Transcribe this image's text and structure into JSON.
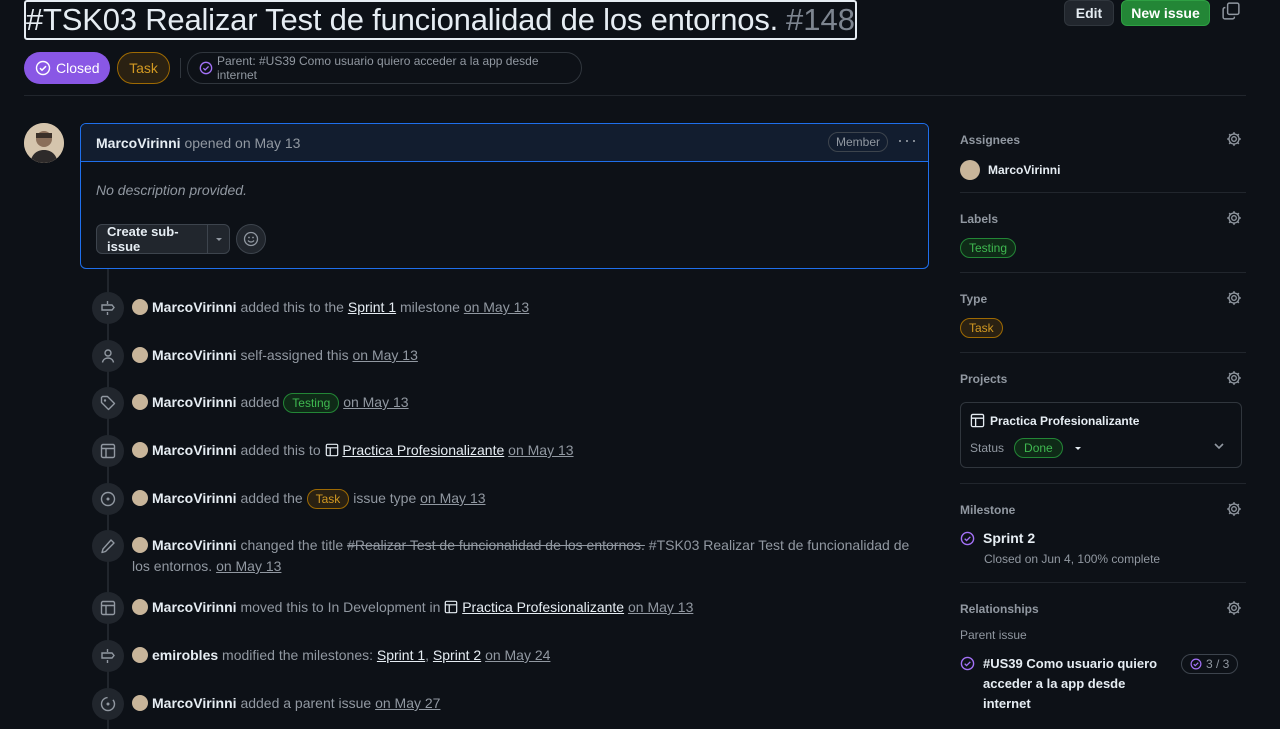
{
  "header": {
    "title": "#TSK03 Realizar Test de funcionalidad de los entornos.",
    "number": "#148",
    "edit_label": "Edit",
    "new_issue_label": "New issue"
  },
  "status": {
    "state_label": "Closed",
    "type_label": "Task",
    "parent_text": "Parent: #US39 Como usuario quiero acceder a la app desde internet"
  },
  "comment": {
    "author": "MarcoVirinni",
    "opened_text": "opened on May 13",
    "role_badge": "Member",
    "body": "No description provided.",
    "sub_issue_label": "Create sub-issue"
  },
  "timeline": [
    {
      "author": "MarcoVirinni",
      "pre": "added this to the",
      "link": "Sprint 1",
      "post": "milestone",
      "date": "on May 13"
    },
    {
      "author": "MarcoVirinni",
      "pre": "self-assigned this",
      "date": "on May 13"
    },
    {
      "author": "MarcoVirinni",
      "pre": "added",
      "label": "Testing",
      "date": "on May 13"
    },
    {
      "author": "MarcoVirinni",
      "pre": "added this to",
      "link": "Practica Profesionalizante",
      "date": "on May 13"
    },
    {
      "author": "MarcoVirinni",
      "pre": "added the",
      "label": "Task",
      "post": "issue type",
      "date": "on May 13"
    },
    {
      "author": "MarcoVirinni",
      "pre": "changed the title",
      "old_title": "#Realizar Test de funcionalidad de los entornos.",
      "new_title": "#TSK03 Realizar Test de funcionalidad de los entornos.",
      "date": "on May 13"
    },
    {
      "author": "MarcoVirinni",
      "pre": "moved this to In Development in",
      "link": "Practica Profesionalizante",
      "date": "on May 13"
    },
    {
      "author": "emirobles",
      "pre": "modified the milestones:",
      "link": "Sprint 1",
      "link2": "Sprint 2",
      "date": "on May 24"
    },
    {
      "author": "MarcoVirinni",
      "pre": "added a parent issue",
      "date": "on May 27"
    }
  ],
  "sidebar": {
    "assignees_h": "Assignees",
    "assignee": "MarcoVirinni",
    "labels_h": "Labels",
    "label": "Testing",
    "type_h": "Type",
    "type": "Task",
    "projects_h": "Projects",
    "project_name": "Practica Profesionalizante",
    "status_label": "Status",
    "status_value": "Done",
    "milestone_h": "Milestone",
    "milestone_name": "Sprint 2",
    "milestone_meta": "Closed on Jun 4, 100% complete",
    "relationships_h": "Relationships",
    "parent_issue_h": "Parent issue",
    "parent_title": "#US39 Como usuario quiero acceder a la app desde internet",
    "parent_count": "3 / 3"
  },
  "colors": {
    "closed": "#8957e5",
    "accent_green": "#238636",
    "task": "#d29922"
  }
}
